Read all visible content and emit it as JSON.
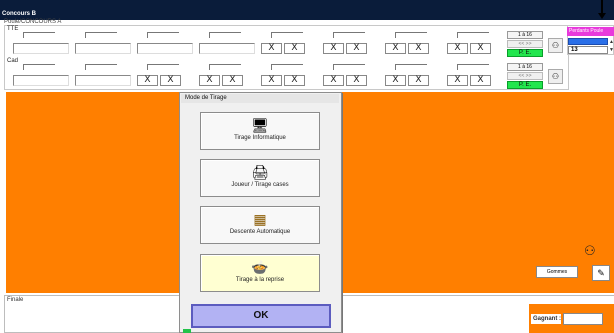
{
  "window": {
    "title": "Concours B"
  },
  "poule": {
    "label": "Poule/CONCOURS A"
  },
  "rows": [
    {
      "label": "TTE",
      "range": "1 à 16",
      "nav": "<<   >>",
      "pe": "P. E."
    },
    {
      "label": "Cad",
      "range": "1 à 16",
      "nav": "<<   >>",
      "pe": "P. E."
    }
  ],
  "x_mark": "X",
  "pending": {
    "title": "Perdants Poule",
    "value": "13"
  },
  "dialog": {
    "title": "Mode de Tirage",
    "buttons": [
      {
        "label": "Tirage Informatique",
        "icon": "computer-icon",
        "glyph": "🖥"
      },
      {
        "label": "Joueur / Tirage cases",
        "icon": "printer-icon",
        "glyph": "🖨"
      },
      {
        "label": "Descente Automatique",
        "icon": "blocks-icon",
        "glyph": "▦"
      },
      {
        "label": "Tirage à la reprise",
        "icon": "pot-icon",
        "glyph": "🍲"
      }
    ],
    "ok": "OK"
  },
  "finale": {
    "label": "Finale"
  },
  "gommes": {
    "label": "Gommes"
  },
  "gagnant": {
    "label": "Gagnant :"
  },
  "colors": {
    "orange": "#ff7f00",
    "green": "#22e64e",
    "magenta": "#e83adc",
    "ok": "#b2b2f3"
  }
}
